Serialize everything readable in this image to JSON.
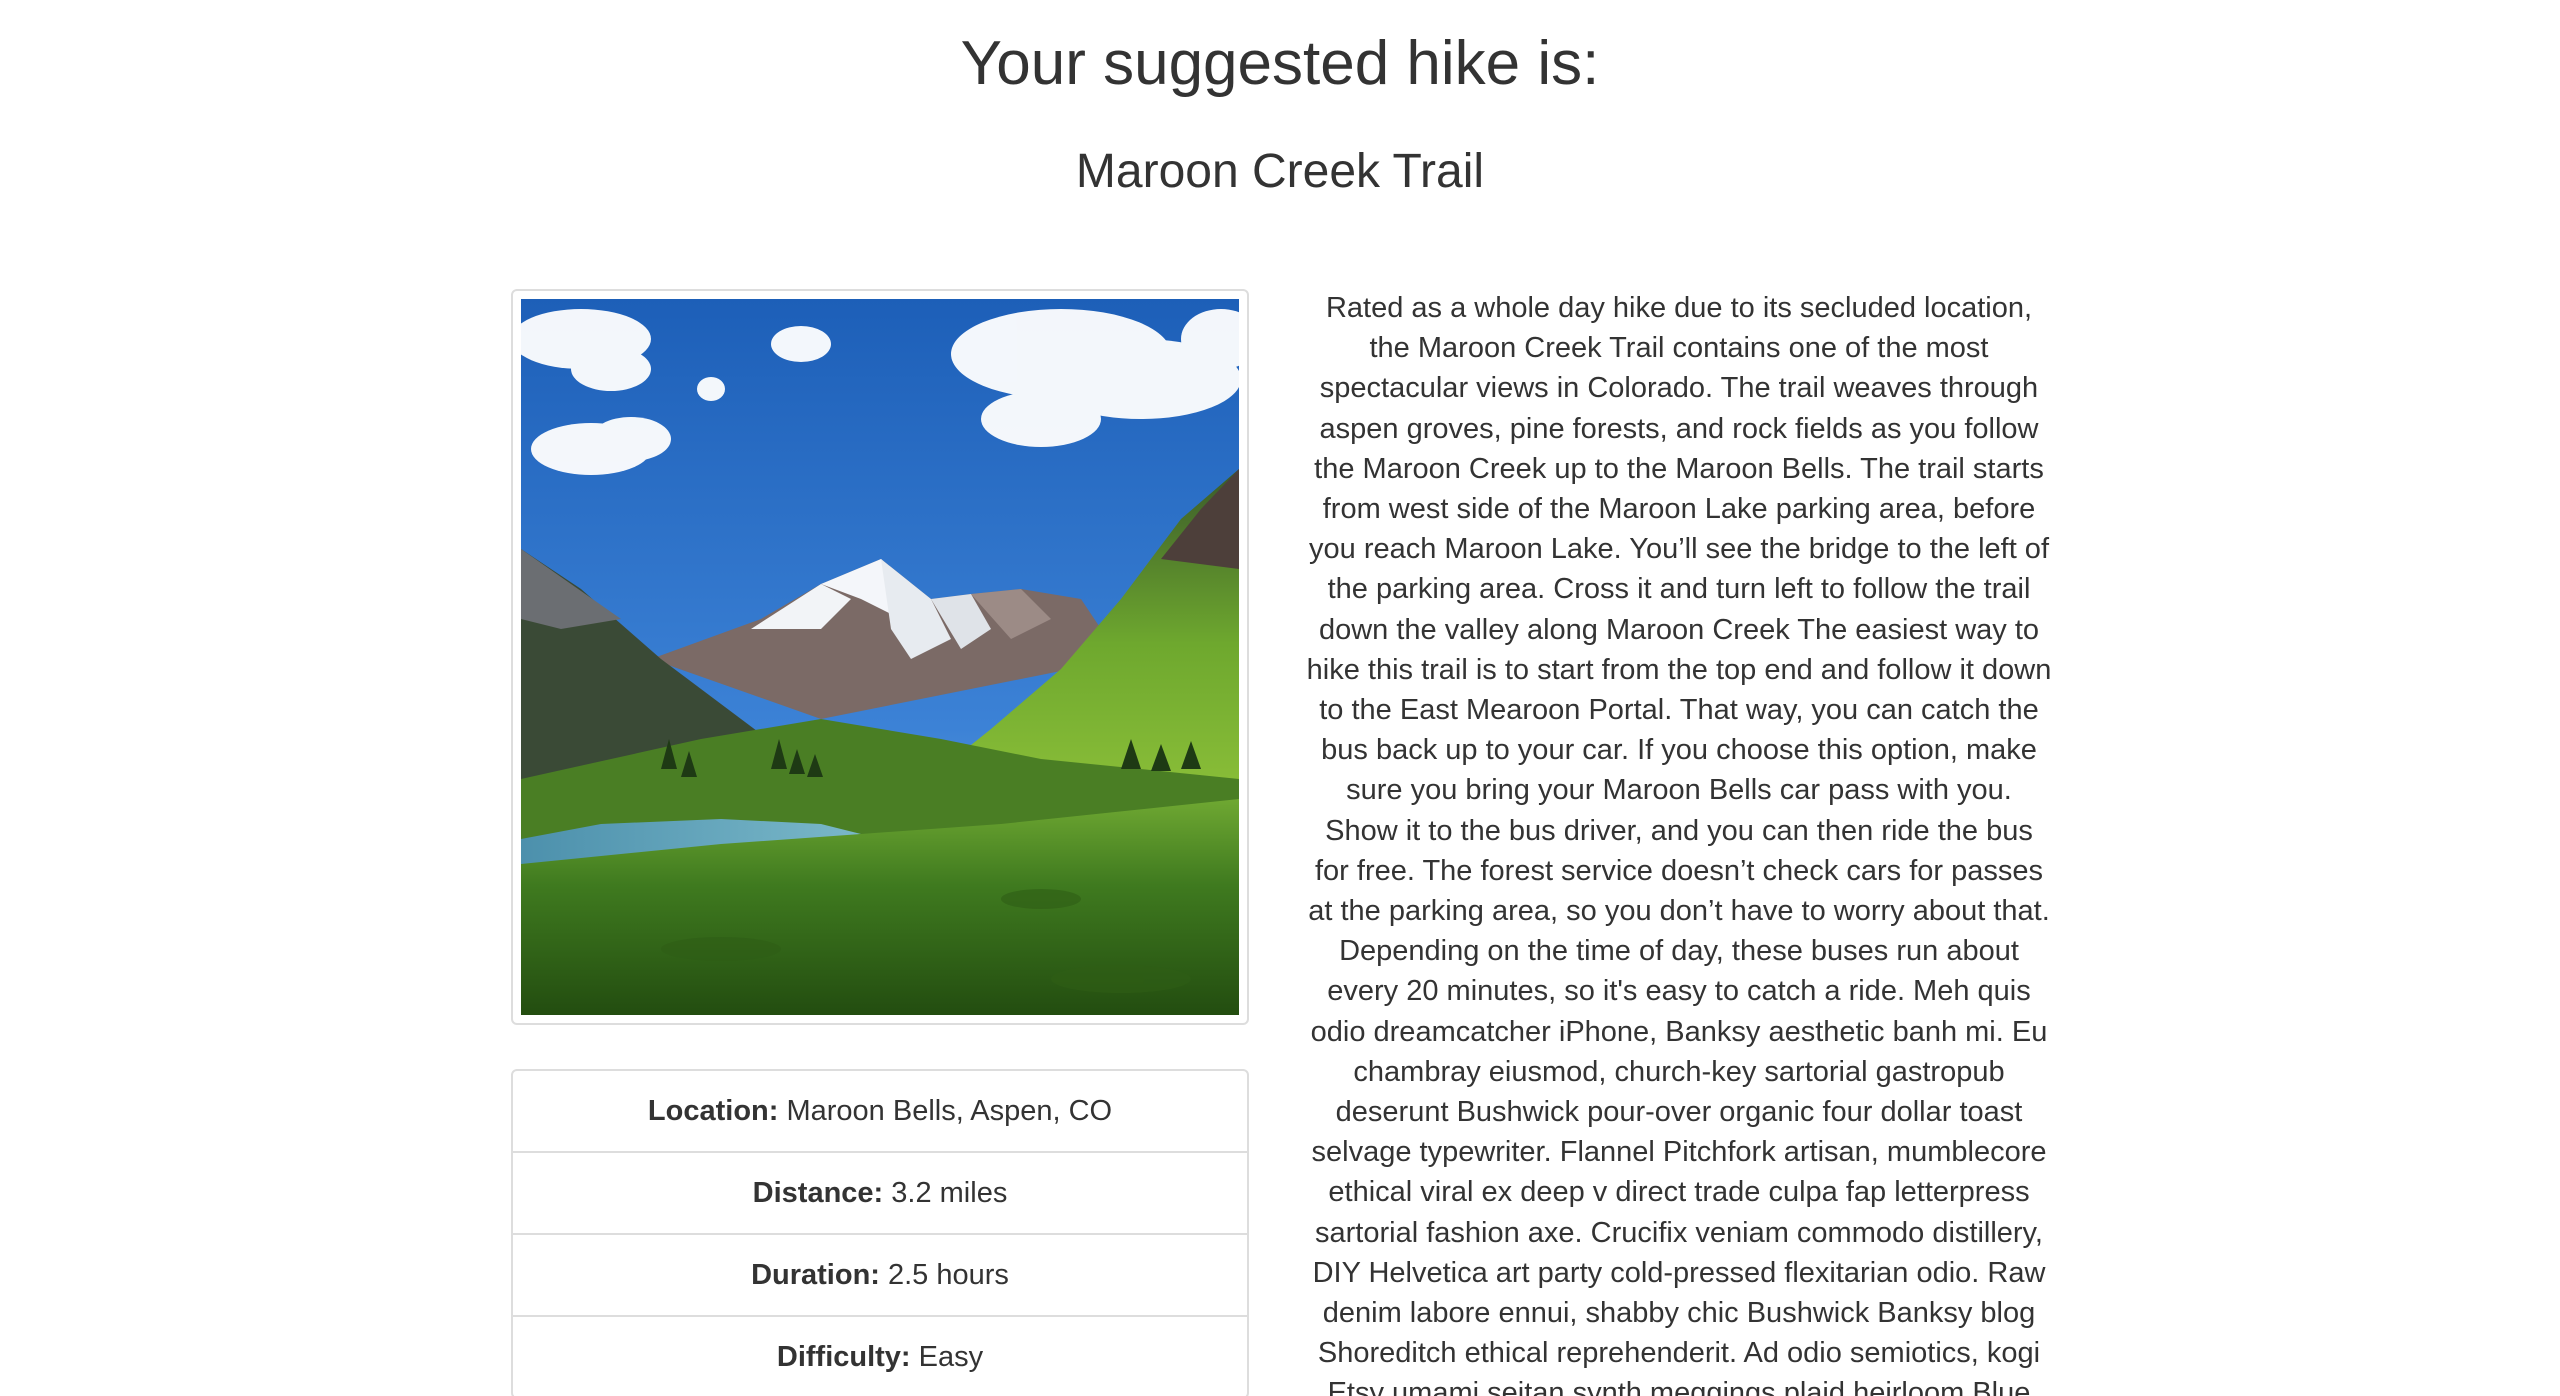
{
  "page": {
    "title": "Your suggested hike is:",
    "trail_name": "Maroon Creek Trail"
  },
  "photo": {
    "subject": "Maroon Bells mountain valley with lake and green meadow"
  },
  "details": [
    {
      "label": "Location:",
      "value": " Maroon Bells, Aspen, CO"
    },
    {
      "label": "Distance:",
      "value": " 3.2 miles"
    },
    {
      "label": "Duration:",
      "value": " 2.5 hours"
    },
    {
      "label": "Difficulty:",
      "value": " Easy"
    }
  ],
  "description": "Rated as a whole day hike due to its secluded location, the Maroon Creek Trail contains one of the most spectacular views in Colorado. The trail weaves through aspen groves, pine forests, and rock fields as you follow the Maroon Creek up to the Maroon Bells. The trail starts from west side of the Maroon Lake parking area, before you reach Maroon Lake. You’ll see the bridge to the left of the parking area. Cross it and turn left to follow the trail down the valley along Maroon Creek The easiest way to hike this trail is to start from the top end and follow it down to the East Mearoon Portal. That way, you can catch the bus back up to your car. If you choose this option, make sure you bring your Maroon Bells car pass with you. Show it to the bus driver, and you can then ride the bus for free. The forest service doesn’t check cars for passes at the parking area, so you don’t have to worry about that. Depending on the time of day, these buses run about every 20 minutes, so it's easy to catch a ride. Meh quis odio dreamcatcher iPhone, Banksy aesthetic banh mi. Eu chambray eiusmod, church-key sartorial gastropub deserunt Bushwick pour-over organic four dollar toast selvage typewriter. Flannel Pitchfork artisan, mumblecore ethical viral ex deep v direct trade culpa fap letterpress sartorial fashion axe. Crucifix veniam commodo distillery, DIY Helvetica art party cold-pressed flexitarian odio. Raw denim labore ennui, shabby chic Bushwick Banksy blog Shoreditch ethical reprehenderit. Ad odio semiotics, kogi Etsy umami seitan synth meggings plaid heirloom Blue Bottle leggings",
  "colors": {
    "text": "#333333",
    "border": "#dddddd",
    "sky": "#2f6fc4",
    "meadow": "#3f7a1f",
    "lake": "#5a9fb8"
  }
}
